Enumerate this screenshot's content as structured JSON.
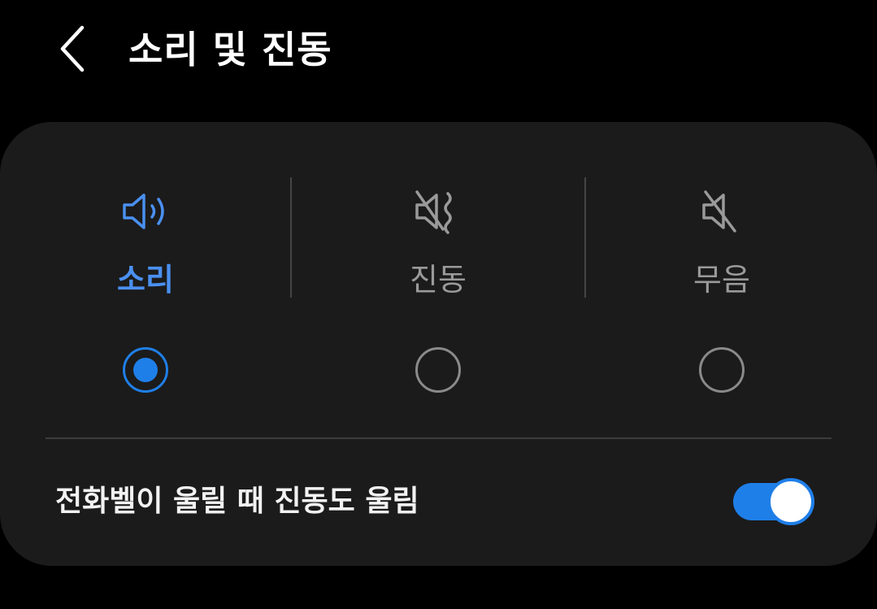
{
  "header": {
    "title": "소리 및 진동"
  },
  "sound_mode": {
    "selected": "sound",
    "options": [
      {
        "id": "sound",
        "label": "소리",
        "icon": "speaker-volume-icon",
        "selected": true
      },
      {
        "id": "vibrate",
        "label": "진동",
        "icon": "vibrate-icon",
        "selected": false
      },
      {
        "id": "mute",
        "label": "무음",
        "icon": "mute-icon",
        "selected": false
      }
    ]
  },
  "vibrate_while_ringing": {
    "label": "전화벨이 울릴 때 진동도 울림",
    "enabled": true
  },
  "colors": {
    "background": "#000000",
    "card": "#1b1b1b",
    "accent": "#1f7fe8",
    "selected_text": "#4a90f0",
    "inactive_text": "#9a9a9a"
  }
}
